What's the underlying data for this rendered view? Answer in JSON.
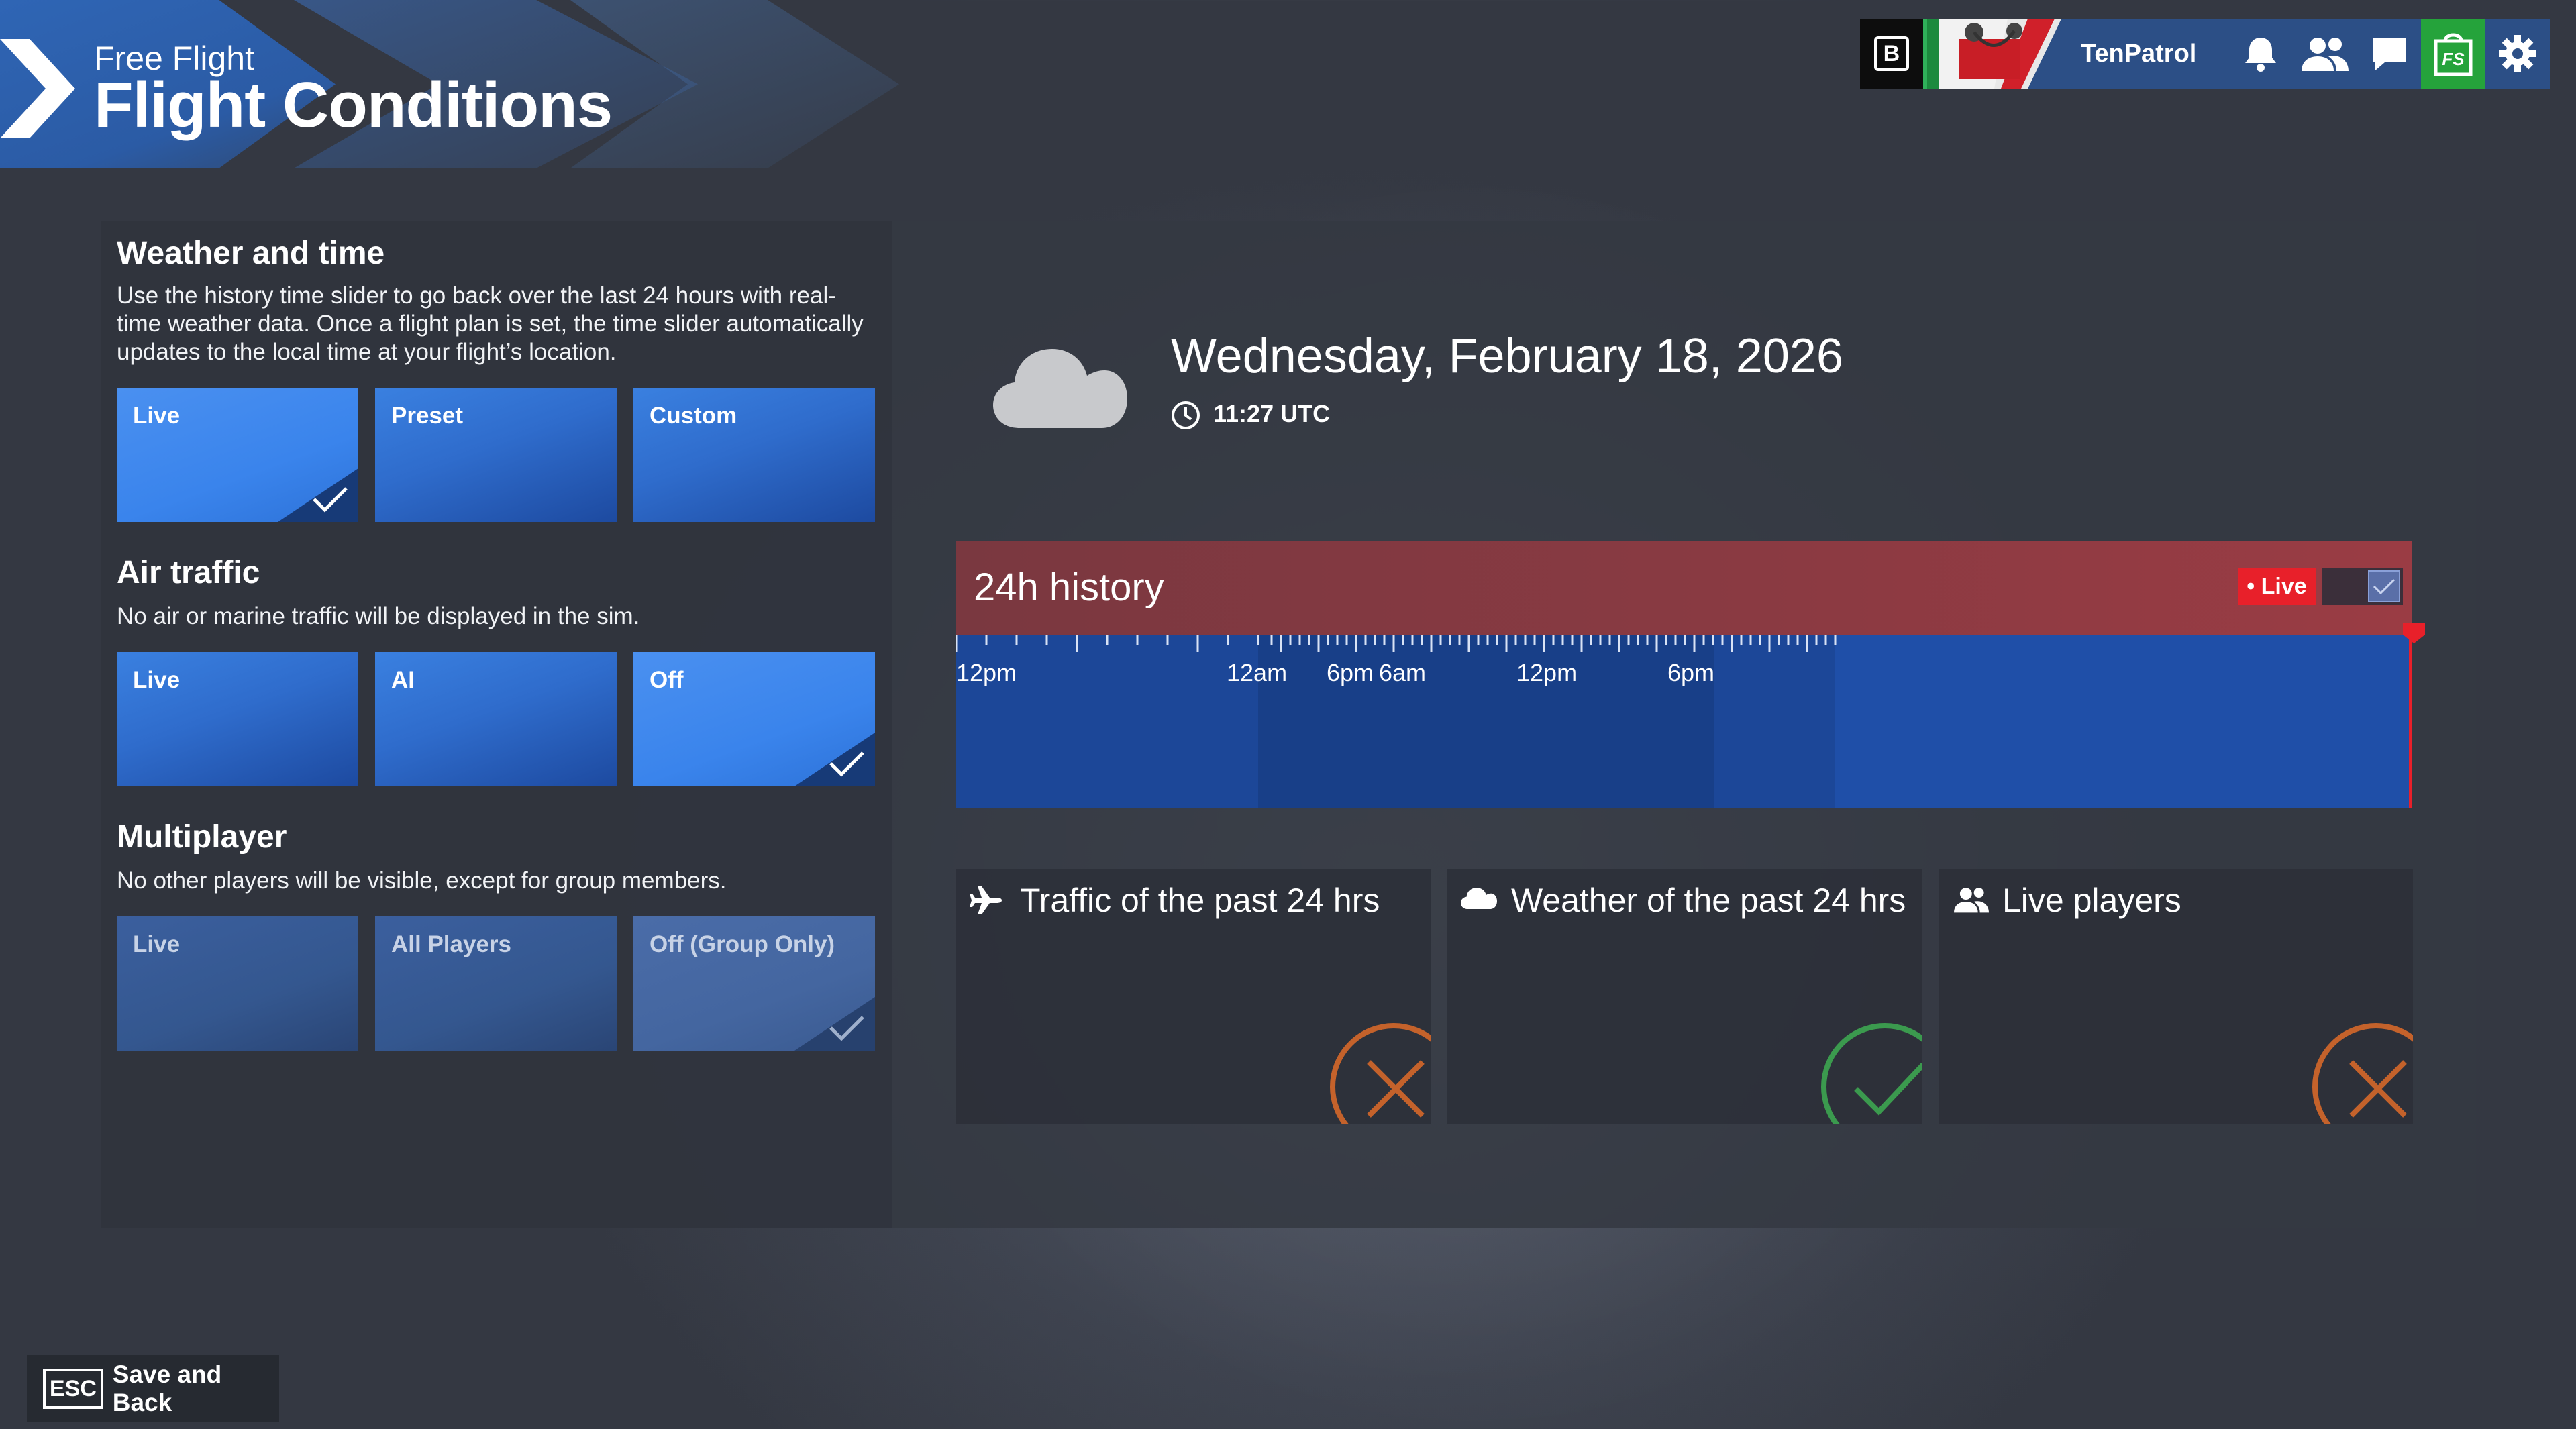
{
  "header": {
    "subtitle": "Free Flight",
    "title": "Flight Conditions"
  },
  "topbar": {
    "badge": "B",
    "username": "TenPatrol",
    "icons": [
      "bell-icon",
      "friends-icon",
      "chat-icon",
      "store-icon",
      "gear-icon"
    ],
    "store_label": "FS"
  },
  "weather_time": {
    "title": "Weather and time",
    "description": "Use the history time slider to go back over the last 24 hours with real-time weather data. Once a flight plan is set, the time slider automatically updates to the local time at your flight’s location.",
    "options": [
      "Live",
      "Preset",
      "Custom"
    ],
    "selected": "Live"
  },
  "air_traffic": {
    "title": "Air traffic",
    "description": "No air or marine traffic will be displayed in the sim.",
    "options": [
      "Live",
      "AI",
      "Off"
    ],
    "selected": "Off"
  },
  "multiplayer": {
    "title": "Multiplayer",
    "description": "No other players will be visible, except for group members.",
    "options": [
      "Live",
      "All Players",
      "Off (Group Only)"
    ],
    "selected": "Off (Group Only)"
  },
  "conditions": {
    "weather_icon": "cloud-icon",
    "date": "Wednesday, February 18, 2026",
    "time": "11:27 UTC"
  },
  "history": {
    "title": "24h history",
    "live_label": "• Live",
    "live_toggle_checked": true,
    "tick_labels": [
      "12pm",
      "12am",
      "6pm",
      "6am",
      "12pm",
      "6pm"
    ],
    "position": 1.0
  },
  "cards": [
    {
      "icon": "plane-icon",
      "title": "Traffic of the past 24 hrs",
      "status": "unavailable"
    },
    {
      "icon": "cloud-icon",
      "title": "Weather of the past 24 hrs",
      "status": "available"
    },
    {
      "icon": "players-icon",
      "title": "Live players",
      "status": "unavailable"
    }
  ],
  "footer": {
    "key": "ESC",
    "label": "Save and Back"
  },
  "colors": {
    "accent_blue": "#3a84ec",
    "live_red": "#e8202a",
    "status_ok": "#3b9a4e",
    "status_off": "#c4622b",
    "store_green": "#25a33b"
  }
}
